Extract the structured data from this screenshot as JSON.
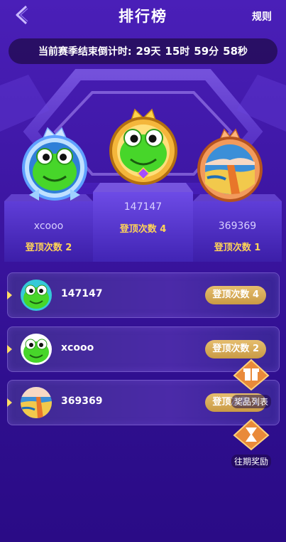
{
  "header": {
    "title": "排行榜",
    "rules_label": "规则"
  },
  "countdown": {
    "label": "当前赛季结束倒计时:",
    "days": "29",
    "days_unit": "天",
    "hours": "15",
    "hours_unit": "时",
    "minutes": "59",
    "minutes_unit": "分",
    "seconds": "58",
    "seconds_unit": "秒"
  },
  "podium": {
    "first": {
      "name": "147147",
      "count_label": "登顶次数 4"
    },
    "second": {
      "name": "xcooo",
      "count_label": "登顶次数 2"
    },
    "third": {
      "name": "369369",
      "count_label": "登顶次数 1"
    }
  },
  "list": [
    {
      "name": "147147",
      "count_label": "登顶次数 4",
      "avatar": "frog-icon"
    },
    {
      "name": "xcooo",
      "count_label": "登顶次数 2",
      "avatar": "frog-icon"
    },
    {
      "name": "369369",
      "count_label": "登顶次数 1",
      "avatar": "beach-icon"
    }
  ],
  "floating": {
    "prize_list": "奖品列表",
    "past_rewards": "往期奖励"
  }
}
